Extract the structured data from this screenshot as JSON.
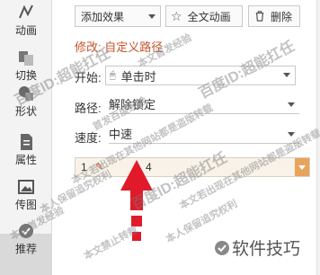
{
  "sidebar": {
    "items": [
      {
        "label": "动画",
        "icon": "animation-icon"
      },
      {
        "label": "切换",
        "icon": "transition-icon"
      },
      {
        "label": "形状",
        "icon": "shape-icon"
      },
      {
        "label": "属性",
        "icon": "properties-icon"
      },
      {
        "label": "传图",
        "icon": "upload-image-icon"
      },
      {
        "label": "推荐",
        "icon": "recommend-icon"
      }
    ]
  },
  "toolbar": {
    "add_effect_label": "添加效果",
    "full_animation_label": "全文动画",
    "delete_label": "删除"
  },
  "panel": {
    "section_title": "修改: 自定义路径",
    "start_label": "开始:",
    "start_value": "单击时",
    "path_label": "路径:",
    "path_value": "解除锁定",
    "speed_label": "速度:",
    "speed_value": "中速",
    "list_item_number": "1",
    "list_item_text": "4"
  },
  "watermarks": {
    "line1": "百度ID:超能扛任",
    "line2": "本文首发经验",
    "line3": "首发百度经验",
    "line4": "本人保留追究权利",
    "line5": "本文禁止转载",
    "line6": "本文若出现在其他网站都是盗版转载"
  },
  "brand": {
    "text": "软件技巧"
  },
  "colors": {
    "accent": "#c5552b",
    "arrow": "#e11a2b",
    "list_highlight": "#e9a35b"
  }
}
